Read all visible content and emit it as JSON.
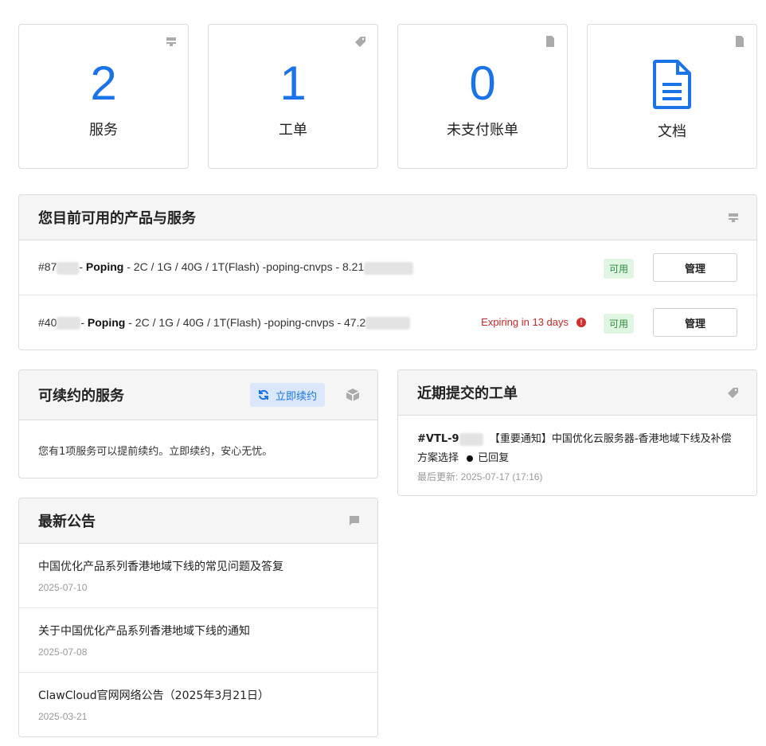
{
  "tiles": [
    {
      "count": "2",
      "label": "服务",
      "icon": "server-icon"
    },
    {
      "count": "1",
      "label": "工单",
      "icon": "tag-icon"
    },
    {
      "count": "0",
      "label": "未支付账单",
      "icon": "document-icon"
    },
    {
      "label": "文档",
      "icon": "document-icon"
    }
  ],
  "services": {
    "title": "您目前可用的产品与服务",
    "items": [
      {
        "id_prefix": "#87",
        "name": "Poping",
        "spec": " - 2C / 1G / 40G / 1T(Flash) -poping-cnvps - 8.21",
        "status": "可用",
        "button": "管理"
      },
      {
        "id_prefix": "#40",
        "name": "Poping",
        "spec": " - 2C / 1G / 40G / 1T(Flash) -poping-cnvps - 47.2",
        "expiring": "Expiring in 13 days",
        "status": "可用",
        "button": "管理"
      }
    ]
  },
  "renewable": {
    "title": "可续约的服务",
    "button": "立即续约",
    "message": "您有1项服务可以提前续约。立即续约，安心无忧。"
  },
  "tickets": {
    "title": "近期提交的工单",
    "ticket_id": "#VTL-9",
    "ticket_title": "【重要通知】中国优化云服务器-香港地域下线及补偿方案选择",
    "ticket_status": "已回复",
    "updated": "最后更新: 2025-07-17 (17:16)"
  },
  "announcements": {
    "title": "最新公告",
    "items": [
      {
        "title": "中国优化产品系列香港地域下线的常见问题及答复",
        "date": "2025-07-10"
      },
      {
        "title": "关于中国优化产品系列香港地域下线的通知",
        "date": "2025-07-08"
      },
      {
        "title": "ClawCloud官网网络公告（2025年3月21日）",
        "date": "2025-03-21"
      }
    ]
  },
  "colors": {
    "accent": "#1a73e8",
    "success": "#2e8b3d",
    "danger": "#c62828"
  }
}
